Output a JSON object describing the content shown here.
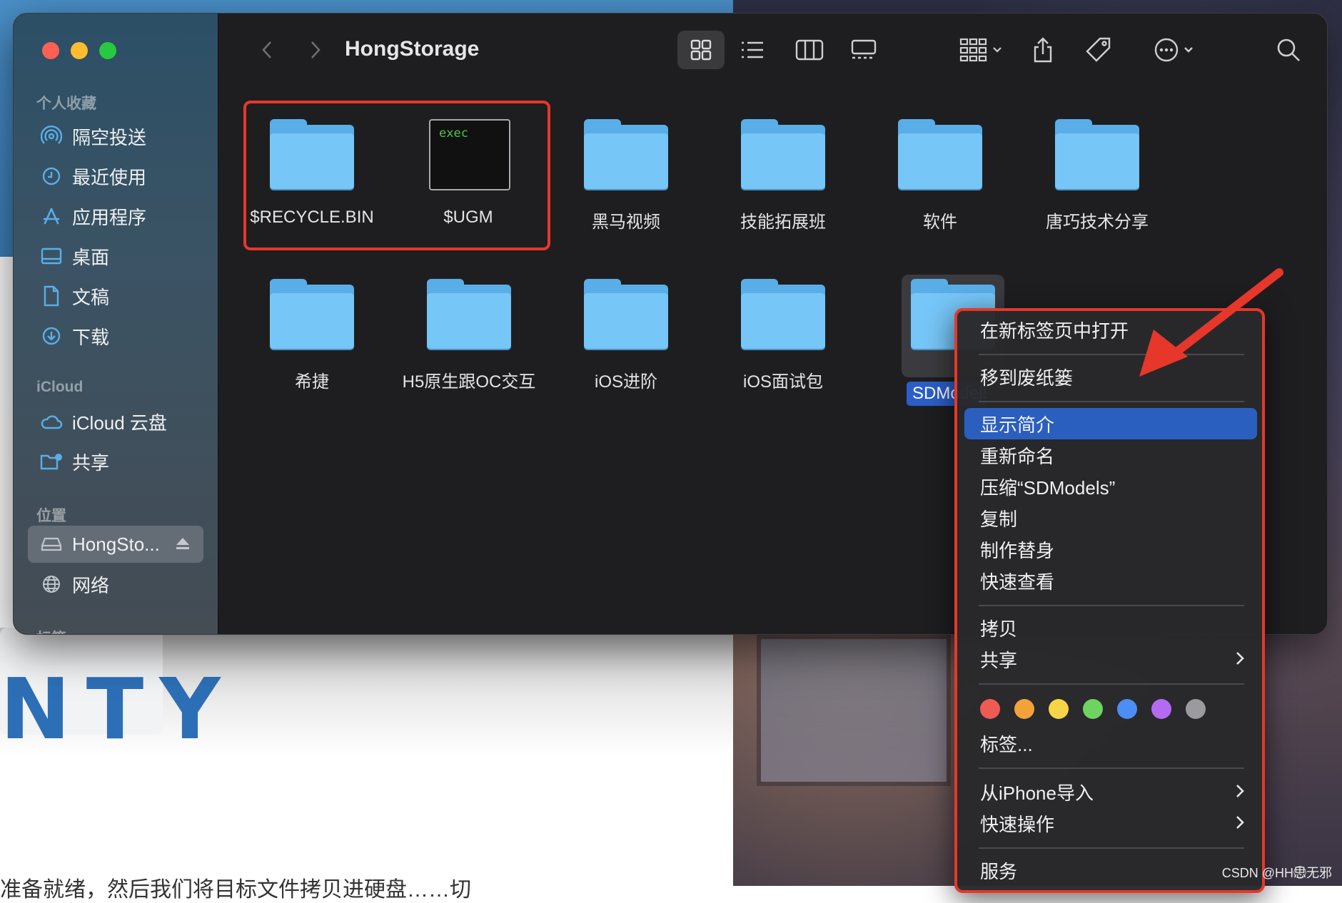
{
  "window": {
    "title": "HongStorage"
  },
  "sidebar": {
    "sections": [
      {
        "title": "个人收藏"
      },
      {
        "title": "iCloud"
      },
      {
        "title": "位置"
      },
      {
        "title": "标签"
      }
    ],
    "items": [
      {
        "label": "隔空投送",
        "icon": "airdrop-icon"
      },
      {
        "label": "最近使用",
        "icon": "clock-icon"
      },
      {
        "label": "应用程序",
        "icon": "apps-icon"
      },
      {
        "label": "桌面",
        "icon": "desktop-icon"
      },
      {
        "label": "文稿",
        "icon": "document-icon"
      },
      {
        "label": "下载",
        "icon": "download-icon"
      },
      {
        "label": "iCloud 云盘",
        "icon": "cloud-icon"
      },
      {
        "label": "共享",
        "icon": "shared-folder-icon"
      },
      {
        "label": "HongSto...",
        "icon": "drive-icon"
      },
      {
        "label": "网络",
        "icon": "globe-icon"
      }
    ]
  },
  "files": [
    {
      "name": "$RECYCLE.BIN",
      "kind": "folder"
    },
    {
      "name": "$UGM",
      "kind": "exec",
      "badge": "exec"
    },
    {
      "name": "黑马视频",
      "kind": "folder"
    },
    {
      "name": "技能拓展班",
      "kind": "folder"
    },
    {
      "name": "软件",
      "kind": "folder"
    },
    {
      "name": "唐巧技术分享",
      "kind": "folder"
    },
    {
      "name": "希捷",
      "kind": "folder"
    },
    {
      "name": "H5原生跟OC交互",
      "kind": "folder"
    },
    {
      "name": "iOS进阶",
      "kind": "folder"
    },
    {
      "name": "iOS面试包",
      "kind": "folder"
    },
    {
      "name": "SDModels",
      "kind": "folder",
      "selected": true
    }
  ],
  "context_menu": {
    "items": [
      "在新标签页中打开",
      "移到废纸篓",
      "显示简介",
      "重新命名",
      "压缩“SDModels”",
      "复制",
      "制作替身",
      "快速查看",
      "拷贝",
      "共享",
      "标签...",
      "从iPhone导入",
      "快速操作",
      "服务"
    ],
    "highlighted": "显示简介",
    "tag_colors": [
      "#ef5a55",
      "#f3a23a",
      "#f6d646",
      "#6fd361",
      "#4c8ef3",
      "#b56af2",
      "#9b9b9f"
    ]
  },
  "background": {
    "logo_text": "NTY",
    "bottom_text": "准备就绪，然后我们将目标文件拷贝进硬盘……切",
    "watermark": "CSDN @HH思⃝⃝无邪"
  },
  "colors": {
    "accent": "#2b5fbf",
    "annotation": "#e7372a",
    "folder": "#76c6f7"
  }
}
